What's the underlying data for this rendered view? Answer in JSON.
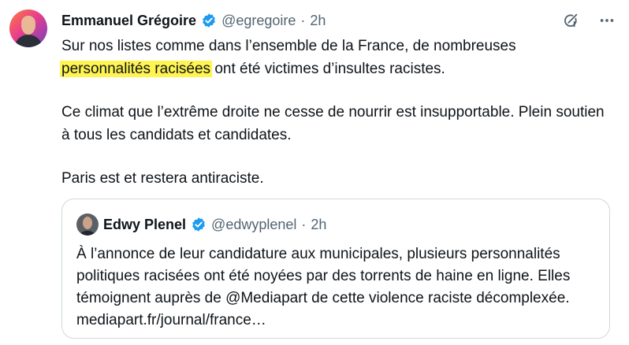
{
  "tweet": {
    "author_name": "Emmanuel Grégoire",
    "handle": "@egregoire",
    "separator": "·",
    "time": "2h",
    "text_line1_before": "Sur nos listes comme dans l’ensemble de la France, de nombreuses ",
    "text_highlight": "personnalités racisées",
    "text_line1_after": " ont été victimes d’insultes racistes.",
    "paragraph2": "Ce climat que l’extrême droite ne cesse de nourrir est insupportable. Plein soutien à tous les candidats et candidates.",
    "paragraph3": "Paris est et restera antiraciste.",
    "icons": [
      "grok-icon",
      "more-icon"
    ]
  },
  "quoted_tweet": {
    "author_name": "Edwy Plenel",
    "handle": "@edwyplenel",
    "separator": "·",
    "time": "2h",
    "text": "À l’annonce de leur candidature aux municipales, plusieurs personnalités politiques racisées ont été noyées par des torrents de haine en ligne. Elles témoignent auprès de @Mediapart de cette violence  raciste décomplexée. mediapart.fr/journal/france…"
  },
  "colors": {
    "verified_blue": "#1d9bf0",
    "highlight": "#fff451",
    "secondary_text": "#536471",
    "border": "#cfd9de"
  }
}
